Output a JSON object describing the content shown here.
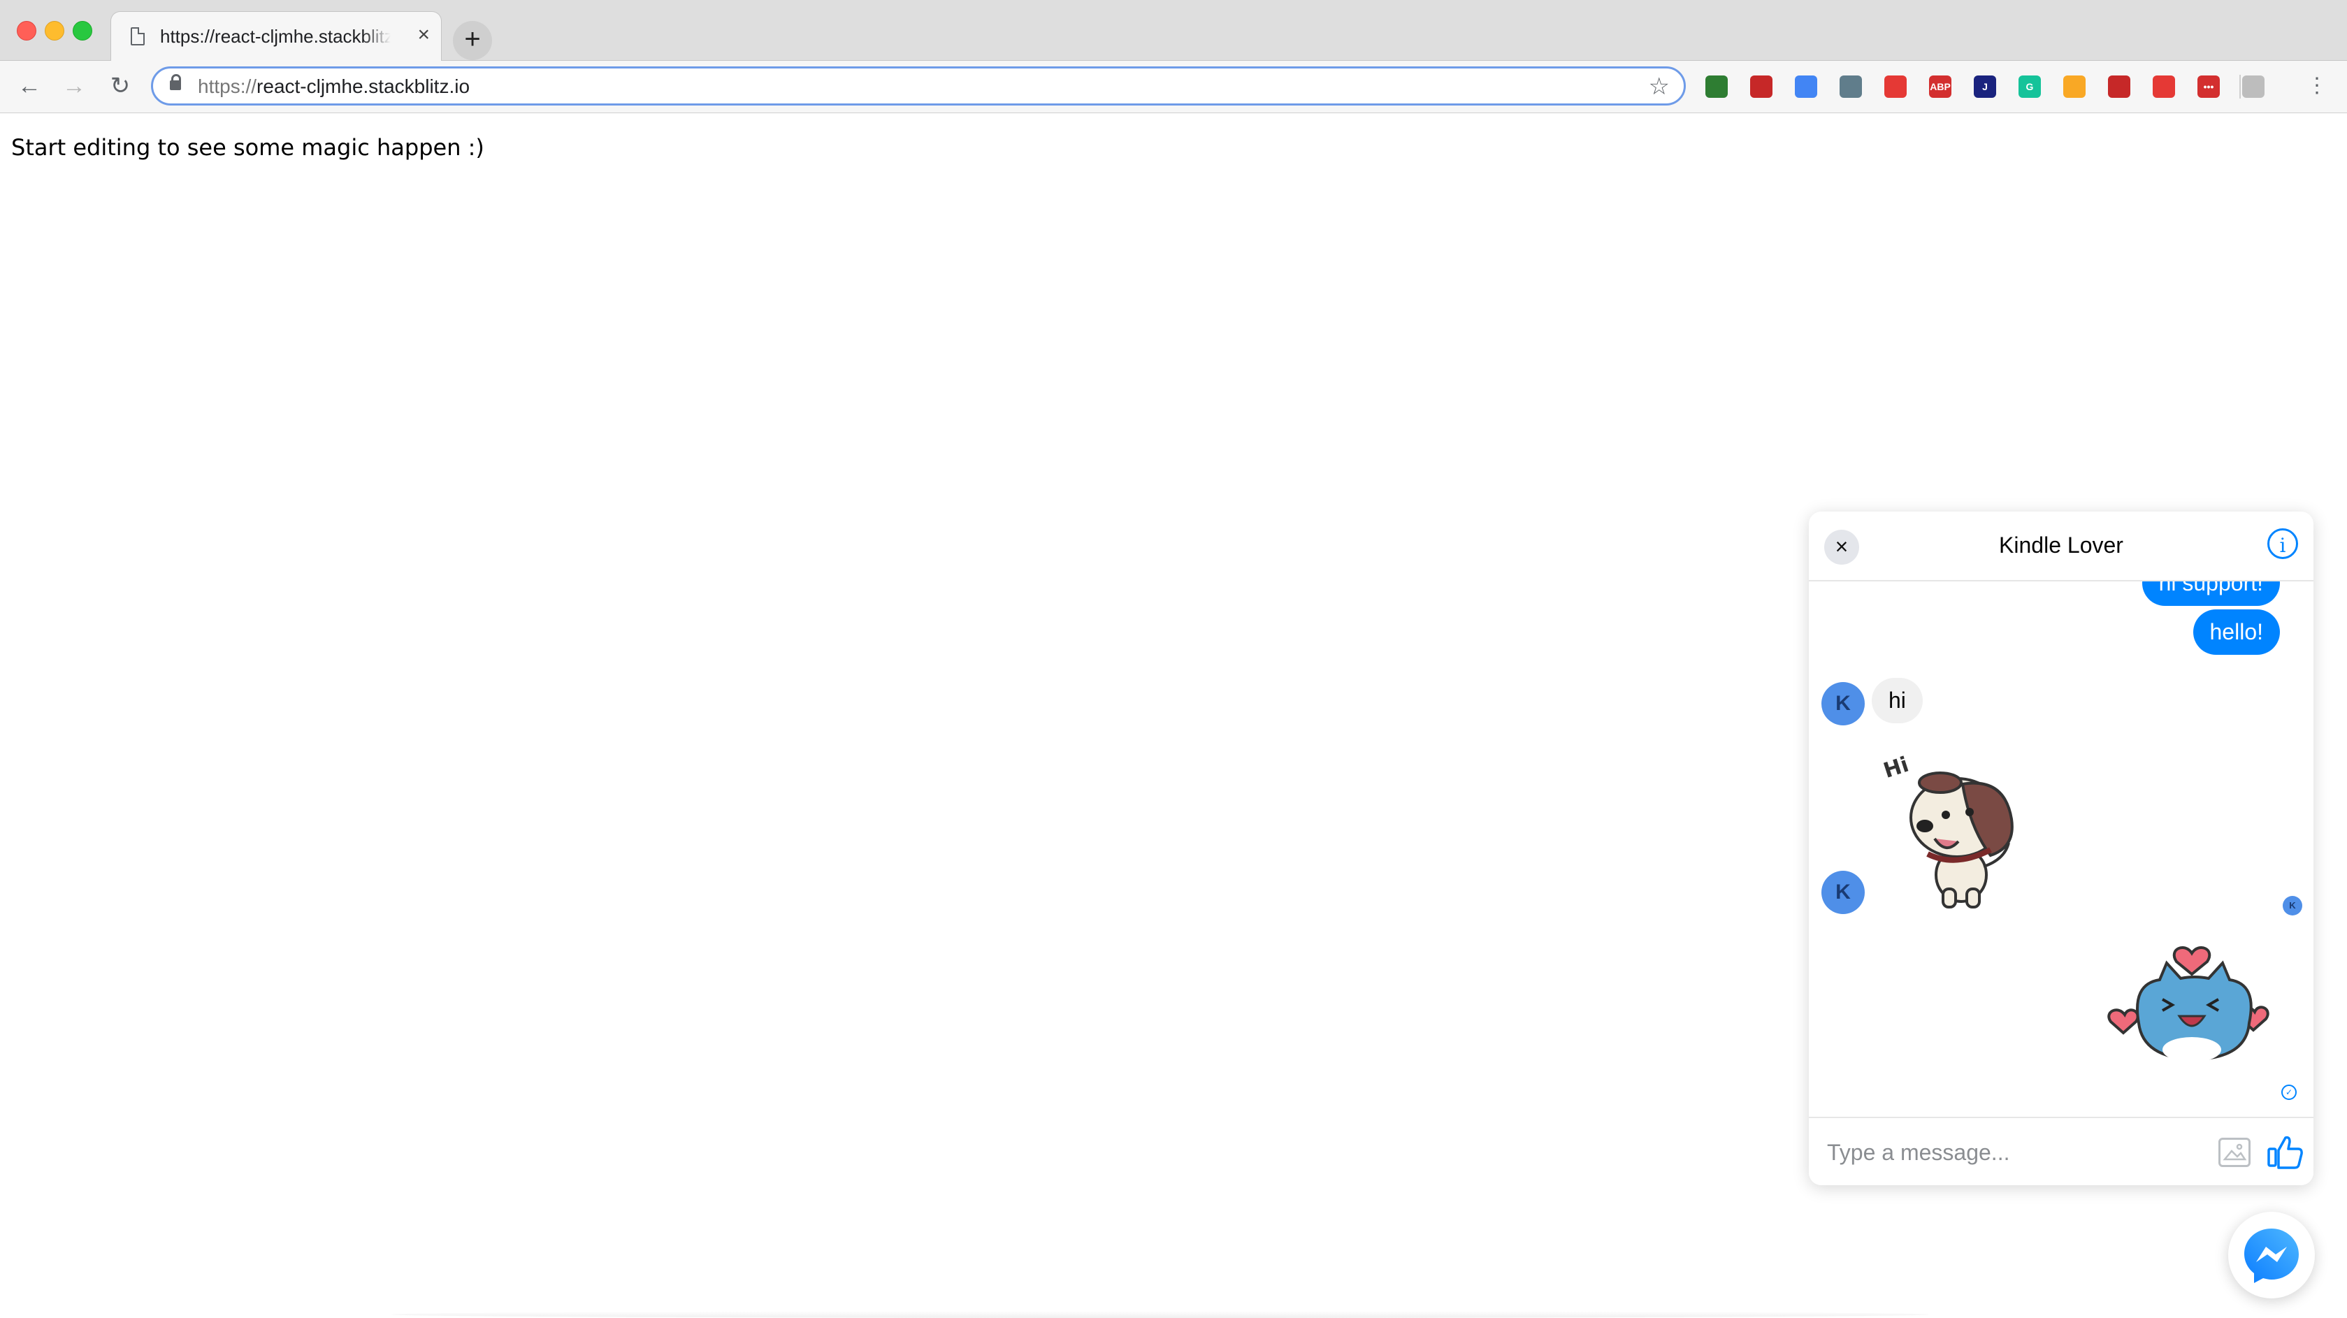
{
  "browser": {
    "tab_title": "https://react-cljmhe.stackblitz.io",
    "tab_close": "×",
    "new_tab": "+",
    "url_scheme": "https://",
    "url_host": "react-cljmhe.stackblitz.io",
    "extensions": [
      {
        "name": "pen-extension-icon",
        "color": "#2e7d32"
      },
      {
        "name": "camera-extension-icon",
        "color": "#c62828"
      },
      {
        "name": "translate-extension-icon",
        "color": "#4285f4"
      },
      {
        "name": "eye-extension-icon",
        "color": "#607d8b"
      },
      {
        "name": "play-extension-icon",
        "color": "#e53935"
      },
      {
        "name": "adblock-extension-icon",
        "color": "#d32f2f",
        "label": "ABP"
      },
      {
        "name": "j-extension-icon",
        "color": "#1a237e",
        "label": "J"
      },
      {
        "name": "grammarly-extension-icon",
        "color": "#15c39a",
        "label": "G"
      },
      {
        "name": "person-check-extension-icon",
        "color": "#f9a825"
      },
      {
        "name": "refresh-extension-icon",
        "color": "#c62828"
      },
      {
        "name": "block-extension-icon",
        "color": "#e53935"
      },
      {
        "name": "dots-extension-icon",
        "color": "#d32f2f",
        "label": "•••"
      },
      {
        "name": "profile-extension-icon",
        "color": "#bdbdbd"
      }
    ]
  },
  "page": {
    "message": "Start editing to see some magic happen :)"
  },
  "chat": {
    "title": "Kindle Lover",
    "close_label": "×",
    "info_label": "i",
    "messages": {
      "out_partial": "hi support!",
      "out_hello": "hello!",
      "in_hi": "hi",
      "avatar_initial": "K",
      "seen_initial": "K",
      "delivered_mark": "✓"
    },
    "composer": {
      "placeholder": "Type a message..."
    }
  },
  "colors": {
    "accent": "#0084ff",
    "incoming_bubble": "#f0f0f0",
    "avatar": "#4f8fe8"
  }
}
